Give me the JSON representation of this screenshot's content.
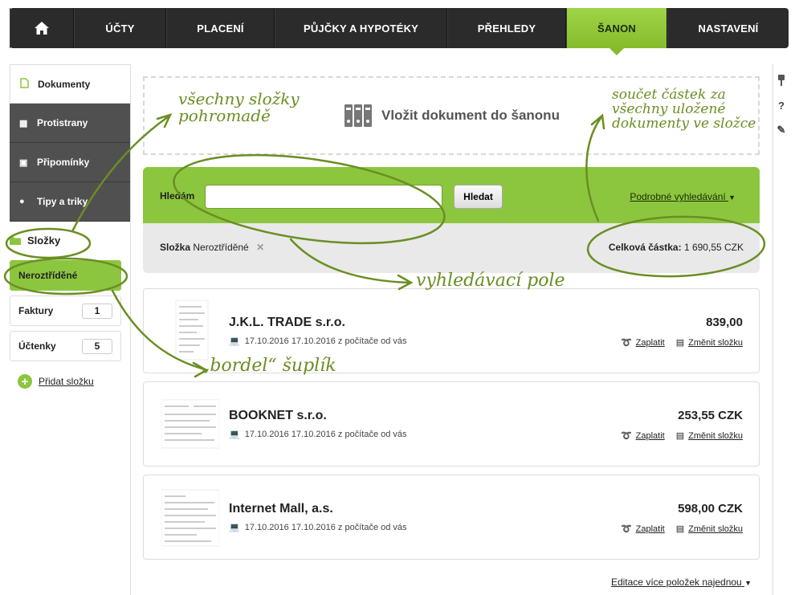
{
  "nav": {
    "home_icon": "home-icon",
    "tabs": [
      {
        "label": "ÚČTY"
      },
      {
        "label": "PLACENÍ"
      },
      {
        "label": "PŮJČKY A HYPOTÉKY"
      },
      {
        "label": "PŘEHLEDY"
      },
      {
        "label": "ŠANON",
        "active": true
      },
      {
        "label": "NASTAVENÍ"
      }
    ]
  },
  "sidebar": {
    "items": [
      {
        "label": "Dokumenty",
        "icon": "document-icon"
      },
      {
        "label": "Protistrany",
        "icon": "counterparties-icon"
      },
      {
        "label": "Připomínky",
        "icon": "calendar-icon"
      },
      {
        "label": "Tipy a triky",
        "icon": "bulb-icon"
      }
    ],
    "folders_heading": "Složky",
    "folders": [
      {
        "label": "Neroztříděné",
        "count": ""
      },
      {
        "label": "Faktury",
        "count": "1"
      },
      {
        "label": "Účtenky",
        "count": "5"
      }
    ],
    "add_folder": "Přidat složku"
  },
  "upload": {
    "label": "Vložit dokument do šanonu"
  },
  "search": {
    "label": "Hledám",
    "input_value": "",
    "button": "Hledat",
    "advanced": "Podrobné vyhledávání"
  },
  "filter": {
    "folder_label": "Složka",
    "folder_value": "Neroztříděné",
    "total_label": "Celková částka:",
    "total_value": "1 690,55 CZK"
  },
  "documents": [
    {
      "name": "J.K.L. TRADE s.r.o.",
      "date": "17.10.2016 17.10.2016 z počítače od vás",
      "amount": "839,00",
      "pay": "Zaplatit",
      "move": "Změnit složku"
    },
    {
      "name": "BOOKNET s.r.o.",
      "date": "17.10.2016 17.10.2016 z počítače od vás",
      "amount": "253,55 CZK",
      "pay": "Zaplatit",
      "move": "Změnit složku"
    },
    {
      "name": "Internet Mall, a.s.",
      "date": "17.10.2016 17.10.2016 z počítače od vás",
      "amount": "598,00 CZK",
      "pay": "Zaplatit",
      "move": "Změnit složku"
    }
  ],
  "bulk_edit": "Editace více položek najednou",
  "rail": {
    "icons": [
      "pin-icon",
      "help-icon",
      "edit-icon"
    ],
    "help_glyph": "?"
  },
  "annotations": {
    "folders_together": [
      "všechny složky",
      "pohromadě"
    ],
    "sum_note": [
      "součet částek za",
      "všechny uložené",
      "dokumenty ve složce"
    ],
    "search_field": "vyhledávací pole",
    "mess_drawer": "„bordel“ šuplík"
  },
  "colors": {
    "accent": "#8cc63f",
    "annotation": "#6a8e23",
    "nav": "#2b2b2b"
  }
}
